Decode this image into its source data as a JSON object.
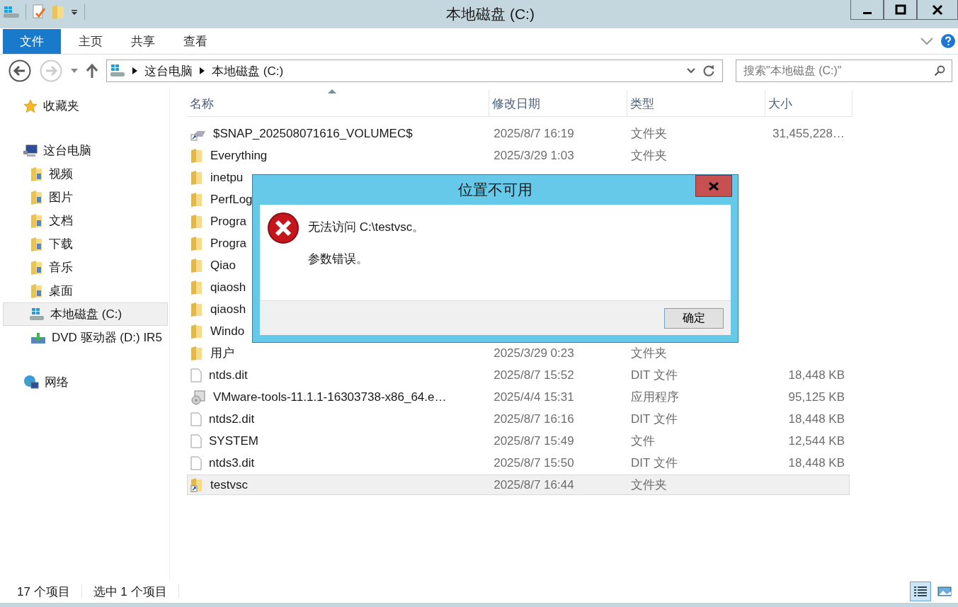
{
  "window": {
    "title": "本地磁盘 (C:)"
  },
  "ribbon_tabs": [
    {
      "label": "文件",
      "kind": "file"
    },
    {
      "label": "主页",
      "kind": "tab"
    },
    {
      "label": "共享",
      "kind": "tab"
    },
    {
      "label": "查看",
      "kind": "tab"
    }
  ],
  "address": {
    "path": [
      "这台电脑",
      "本地磁盘 (C:)"
    ],
    "search_placeholder": "搜索\"本地磁盘 (C:)\""
  },
  "sidebar": {
    "groups": [
      {
        "label": "收藏夹",
        "kind": "star",
        "selected": false
      },
      {
        "label": "这台电脑",
        "kind": "computer",
        "selected": false,
        "children": [
          {
            "label": "视频",
            "kind": "folder",
            "selected": false
          },
          {
            "label": "图片",
            "kind": "folder",
            "selected": false
          },
          {
            "label": "文档",
            "kind": "folder",
            "selected": false
          },
          {
            "label": "下载",
            "kind": "folder",
            "selected": false
          },
          {
            "label": "音乐",
            "kind": "folder",
            "selected": false
          },
          {
            "label": "桌面",
            "kind": "folder",
            "selected": false
          },
          {
            "label": "本地磁盘 (C:)",
            "kind": "drive",
            "selected": true
          },
          {
            "label": "DVD 驱动器 (D:) IR5",
            "kind": "dvd",
            "selected": false
          }
        ]
      },
      {
        "label": "网络",
        "kind": "network",
        "selected": false
      }
    ]
  },
  "table": {
    "columns": [
      "名称",
      "修改日期",
      "类型",
      "大小"
    ],
    "rows": [
      {
        "name": "$SNAP_202508071616_VOLUMEC$",
        "date": "2025/8/7 16:19",
        "type": "文件夹",
        "size": "31,455,228…",
        "kind": "shortcut",
        "selected": false
      },
      {
        "name": "Everything",
        "date": "2025/3/29 1:03",
        "type": "文件夹",
        "kind": "folder",
        "selected": false
      },
      {
        "name": "inetpu",
        "kind": "folder",
        "selected": false
      },
      {
        "name": "PerfLog",
        "kind": "folder",
        "selected": false
      },
      {
        "name": "Progra",
        "kind": "folder",
        "selected": false
      },
      {
        "name": "Progra",
        "kind": "folder",
        "selected": false
      },
      {
        "name": "Qiao",
        "kind": "folder",
        "selected": false
      },
      {
        "name": "qiaosh",
        "kind": "folder",
        "selected": false
      },
      {
        "name": "qiaosh",
        "kind": "folder",
        "selected": false
      },
      {
        "name": "Windo",
        "kind": "folder",
        "selected": false
      },
      {
        "name": "用户",
        "date": "2025/3/29 0:23",
        "type": "文件夹",
        "kind": "folder",
        "selected": false
      },
      {
        "name": "ntds.dit",
        "date": "2025/8/7 15:52",
        "type": "DIT 文件",
        "size": "18,448 KB",
        "kind": "file",
        "selected": false
      },
      {
        "name": "VMware-tools-11.1.1-16303738-x86_64.e…",
        "date": "2025/4/4 15:31",
        "type": "应用程序",
        "size": "95,125 KB",
        "kind": "exe",
        "selected": false
      },
      {
        "name": "ntds2.dit",
        "date": "2025/8/7 16:16",
        "type": "DIT 文件",
        "size": "18,448 KB",
        "kind": "file",
        "selected": false
      },
      {
        "name": "SYSTEM",
        "date": "2025/8/7 15:49",
        "type": "文件",
        "size": "12,544 KB",
        "kind": "file",
        "selected": false
      },
      {
        "name": "ntds3.dit",
        "date": "2025/8/7 15:50",
        "type": "DIT 文件",
        "size": "18,448 KB",
        "kind": "file",
        "selected": false
      },
      {
        "name": "testvsc",
        "date": "2025/8/7 16:44",
        "type": "文件夹",
        "kind": "folder-shortcut",
        "selected": true
      }
    ]
  },
  "dialog": {
    "title": "位置不可用",
    "message": "无法访问 C:\\testvsc。",
    "detail": "参数错误。",
    "button": "确定"
  },
  "status_bar": {
    "count": "17 个项目",
    "selection": "选中 1 个项目",
    "views": [
      {
        "kind": "details",
        "selected": true
      },
      {
        "kind": "thumbnails",
        "selected": false
      }
    ]
  }
}
